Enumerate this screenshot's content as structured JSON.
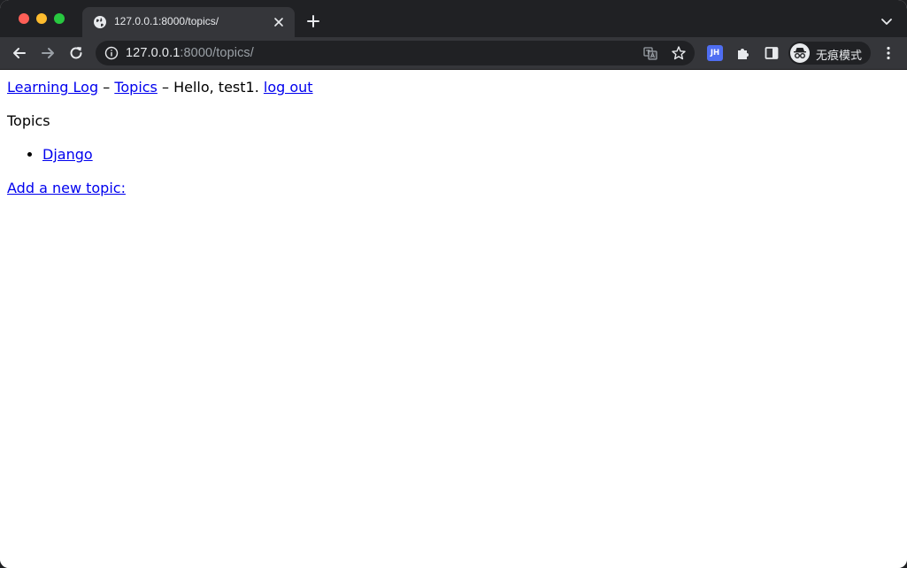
{
  "browser": {
    "tab_title": "127.0.0.1:8000/topics/",
    "url_host": "127.0.0.1",
    "url_rest": ":8000/topics/",
    "extension_label": "JH",
    "profile_label": "无痕模式"
  },
  "page": {
    "nav": {
      "home_link": "Learning Log",
      "sep1": "–",
      "topics_link": "Topics",
      "sep2": "–",
      "greeting": "Hello, test1.",
      "logout_link": "log out"
    },
    "heading": "Topics",
    "topics": [
      {
        "label": "Django"
      }
    ],
    "add_topic_link": "Add a new topic:"
  },
  "colors": {
    "link": "#0000ee",
    "chrome_frame": "#202124",
    "chrome_toolbar": "#35363a"
  }
}
